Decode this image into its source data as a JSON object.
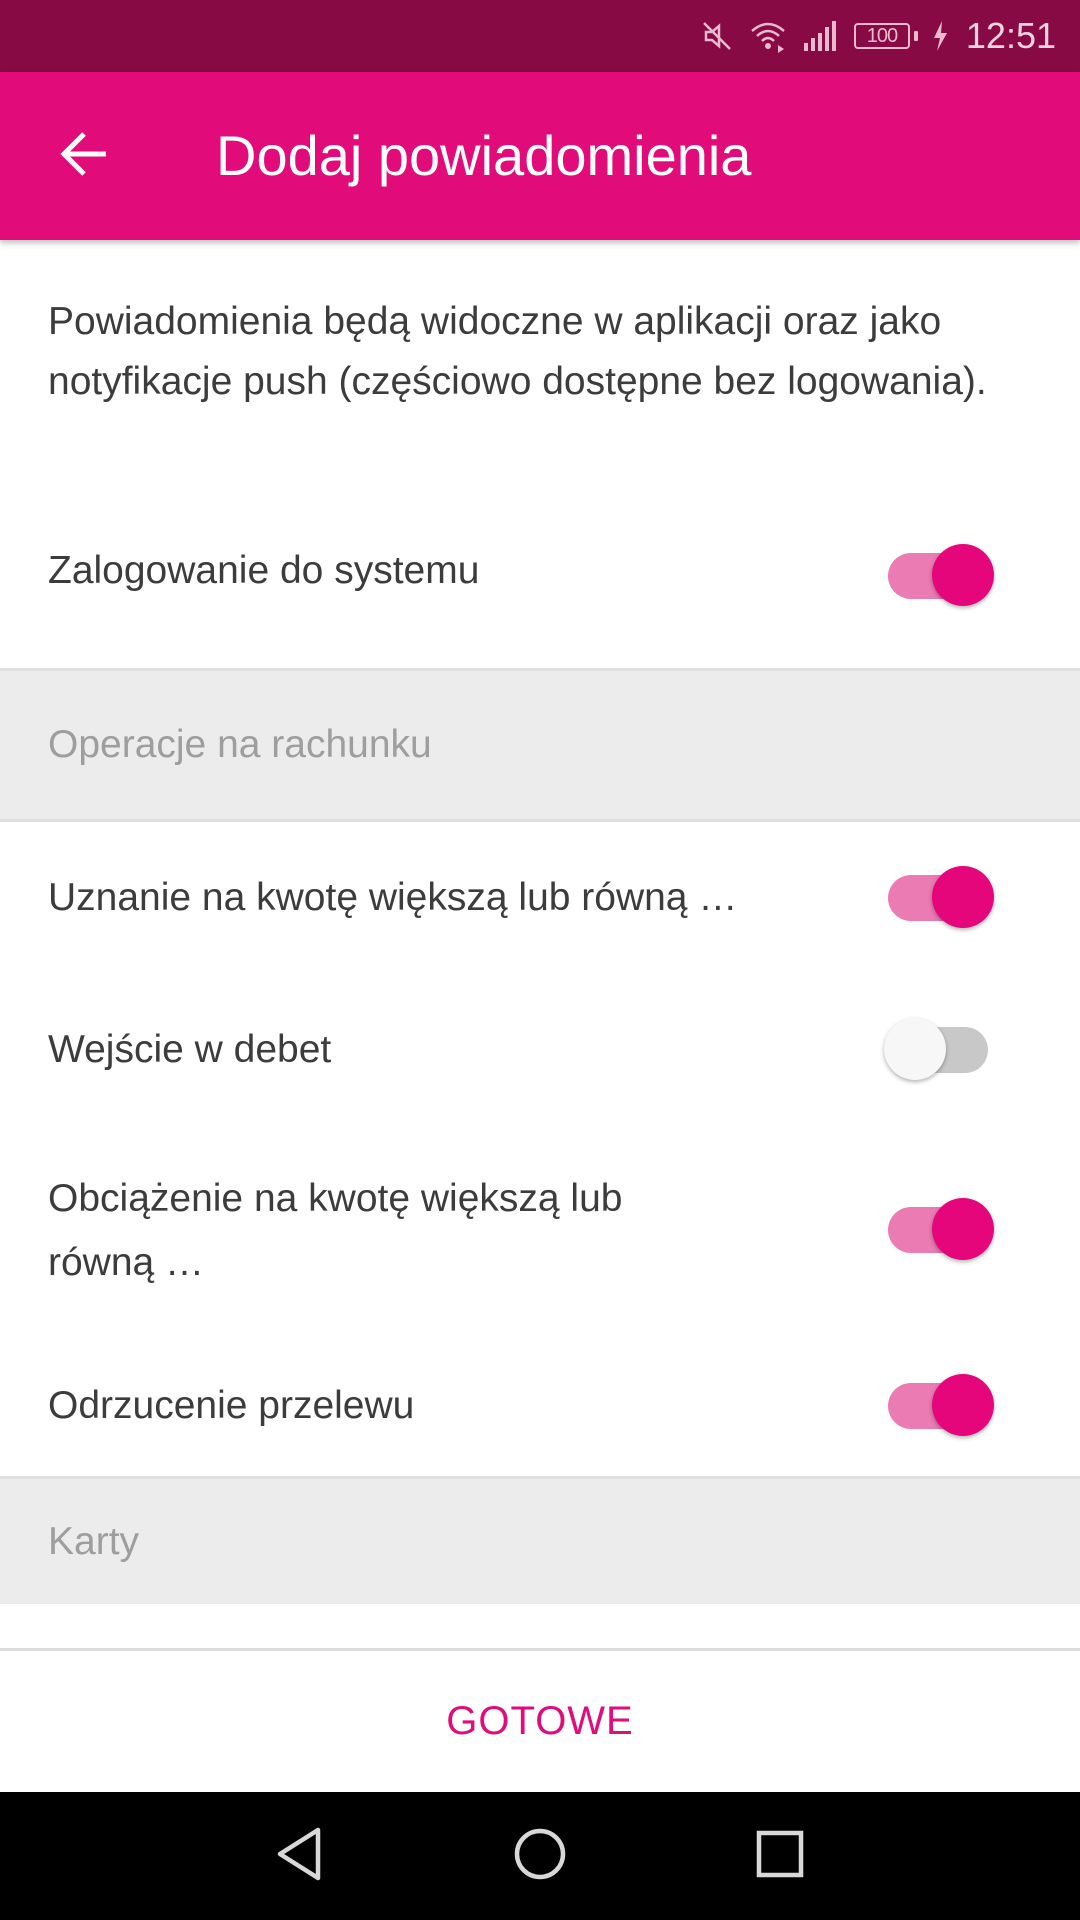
{
  "status_bar": {
    "time": "12:51",
    "battery": "100",
    "icons": [
      "mute-icon",
      "wifi-icon",
      "signal-icon",
      "battery-icon",
      "charging-icon"
    ]
  },
  "app_bar": {
    "title": "Dodaj powiadomienia",
    "back_icon": "arrow-back-icon"
  },
  "intro_text": "Powiadomienia będą widoczne w aplikacji oraz jako notyfikacje push (częściowo dostępne bez logowania).",
  "login_setting": {
    "label": "Zalogowanie do systemu",
    "enabled": true
  },
  "sections": [
    {
      "title": "Operacje na rachunku",
      "items": [
        {
          "label": "Uznanie na kwotę większą lub równą …",
          "enabled": true
        },
        {
          "label": "Wejście w debet",
          "enabled": false
        },
        {
          "label": "Obciążenie na kwotę większą lub równą …",
          "enabled": true
        },
        {
          "label": "Odrzucenie przelewu",
          "enabled": true
        }
      ]
    },
    {
      "title": "Karty",
      "items": []
    }
  ],
  "done_button": "GOTOWE",
  "nav_bar": {
    "icons": [
      "back-triangle-icon",
      "home-circle-icon",
      "recents-square-icon"
    ]
  },
  "colors": {
    "status_bar": "#880a45",
    "app_bar": "#e20b7a",
    "toggle_on_knob": "#e6067b",
    "toggle_on_track": "#eb7bb3",
    "toggle_off_knob": "#f7f7f7",
    "toggle_off_track": "#c8c8c8",
    "section_bg": "#ececec"
  }
}
